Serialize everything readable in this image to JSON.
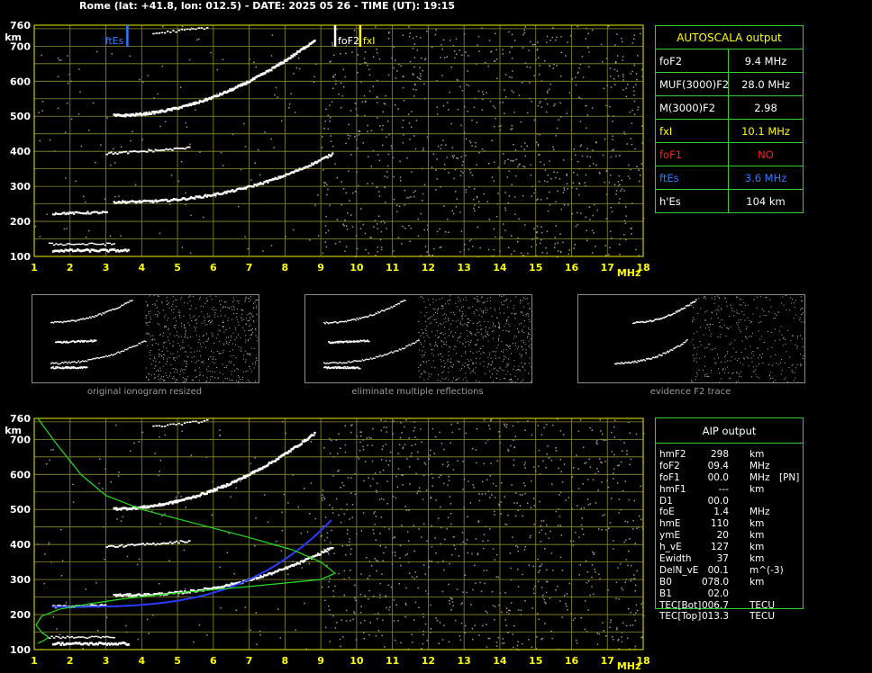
{
  "header": {
    "title": "Rome (lat: +41.8, lon: 012.5) - DATE: 2025 05 26 - TIME (UT): 19:15"
  },
  "colors": {
    "grid": "#8c8c2c",
    "frame": "#c8c800",
    "trace": "#ffffff",
    "noise": "#9a9a9a",
    "fxI": "#ffff00",
    "foF1": "#ff2020",
    "ftEs": "#2a7bff",
    "panel_border": "#2fd02f",
    "profile": "#22dd22",
    "fit": "#2a3bff"
  },
  "chart_data": [
    {
      "type": "scatter",
      "name": "top-ionogram",
      "xlim": [
        1,
        18
      ],
      "ylim": [
        100,
        760
      ],
      "xticks": [
        "1",
        "2",
        "3",
        "4",
        "5",
        "6",
        "7",
        "8",
        "9",
        "10",
        "11",
        "12",
        "13",
        "14",
        "15",
        "16",
        "17",
        "18"
      ],
      "yticks": [
        "100",
        "200",
        "300",
        "400",
        "500",
        "600",
        "700",
        "760"
      ],
      "xunit": "MHz",
      "yunit": "km",
      "markers": [
        {
          "label": "ftEs",
          "x": 3.6
        },
        {
          "label": "foF2",
          "x": 9.4
        },
        {
          "label": "fxI",
          "x": 10.1
        }
      ]
    },
    {
      "type": "scatter",
      "name": "bottom-ionogram",
      "xlim": [
        1,
        18
      ],
      "ylim": [
        100,
        760
      ],
      "xticks": [
        "1",
        "2",
        "3",
        "4",
        "5",
        "6",
        "7",
        "8",
        "9",
        "10",
        "11",
        "12",
        "13",
        "14",
        "15",
        "16",
        "17",
        "18"
      ],
      "yticks": [
        "100",
        "200",
        "300",
        "400",
        "500",
        "600",
        "700",
        "760"
      ],
      "xunit": "MHz",
      "yunit": "km"
    }
  ],
  "autoscala": {
    "title": "AUTOSCALA output",
    "rows": [
      {
        "name": "foF2",
        "value": "9.4 MHz",
        "color": "#ffffff"
      },
      {
        "name": "MUF(3000)F2",
        "value": "28.0 MHz",
        "color": "#ffffff"
      },
      {
        "name": "M(3000)F2",
        "value": "2.98",
        "color": "#ffffff"
      },
      {
        "name": "fxI",
        "value": "10.1 MHz",
        "color": "#ffff00"
      },
      {
        "name": "foF1",
        "value": "NO",
        "color": "#ff2020"
      },
      {
        "name": "ftEs",
        "value": "3.6 MHz",
        "color": "#2a7bff"
      },
      {
        "name": "h'Es",
        "value": "104    km",
        "color": "#ffffff"
      }
    ]
  },
  "aip": {
    "title": "AIP output",
    "rows": [
      {
        "name": "hmF2",
        "value": "298",
        "unit": "km",
        "note": ""
      },
      {
        "name": "foF2",
        "value": "09.4",
        "unit": "MHz",
        "note": ""
      },
      {
        "name": "foF1",
        "value": "00.0",
        "unit": "MHz",
        "note": "[PN]"
      },
      {
        "name": "hmF1",
        "value": "---",
        "unit": "km",
        "note": ""
      },
      {
        "name": "D1",
        "value": "00.0",
        "unit": "",
        "note": ""
      },
      {
        "name": "foE",
        "value": "1.4",
        "unit": "MHz",
        "note": ""
      },
      {
        "name": "hmE",
        "value": "110",
        "unit": "km",
        "note": ""
      },
      {
        "name": "ymE",
        "value": "20",
        "unit": "km",
        "note": ""
      },
      {
        "name": "h_vE",
        "value": "127",
        "unit": "km",
        "note": ""
      },
      {
        "name": "Ewidth",
        "value": "37",
        "unit": "km",
        "note": ""
      },
      {
        "name": "DelN_vE",
        "value": "00.1",
        "unit": "m^(-3)",
        "note": ""
      },
      {
        "name": "B0",
        "value": "078.0",
        "unit": "km",
        "note": ""
      },
      {
        "name": "B1",
        "value": "02.0",
        "unit": "",
        "note": ""
      },
      {
        "name": "TEC[Bot]",
        "value": "006.7",
        "unit": "TECU",
        "note": ""
      },
      {
        "name": "TEC[Top]",
        "value": "013.3",
        "unit": "TECU",
        "note": ""
      }
    ]
  },
  "thumbnails": [
    {
      "caption": "original ionogram resized"
    },
    {
      "caption": "eliminate multiple reflections"
    },
    {
      "caption": "evidence F2 trace"
    }
  ]
}
